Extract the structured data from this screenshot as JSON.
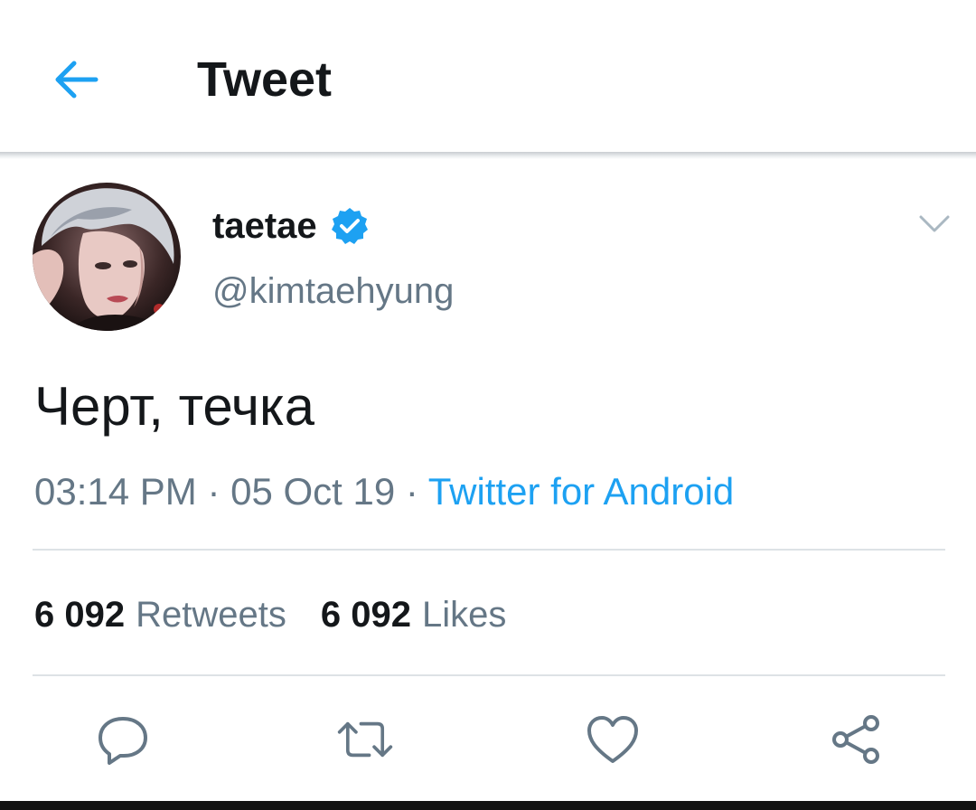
{
  "header": {
    "title": "Tweet",
    "back_icon": "arrow-left-icon"
  },
  "tweet": {
    "display_name": "taetae",
    "verified": true,
    "handle": "@kimtaehyung",
    "text": "Черт, течка",
    "time": "03:14 PM",
    "separator": " · ",
    "date": "05 Oct 19",
    "source": "Twitter for Android"
  },
  "stats": {
    "retweets_count": "6 092",
    "retweets_label": "Retweets",
    "likes_count": "6 092",
    "likes_label": "Likes"
  },
  "actions": [
    "reply-icon",
    "retweet-icon",
    "like-icon",
    "share-icon"
  ],
  "colors": {
    "accent": "#1da1f2",
    "text": "#14171a",
    "muted": "#657786",
    "icon": "#657786"
  }
}
